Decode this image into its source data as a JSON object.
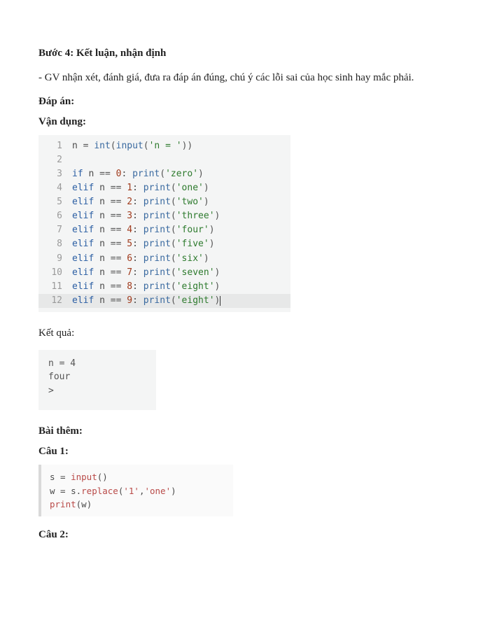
{
  "step_heading": "Bước 4: Kết luận, nhận định",
  "step_body": "- GV nhận xét, đánh giá, đưa ra đáp án đúng, chú ý các lỗi sai của học sinh hay mắc phải.",
  "answer_label": "Đáp án:",
  "apply_label": "Vận dụng:",
  "code_lines": [
    {
      "n": "1",
      "tokens": [
        "n ",
        "=",
        " ",
        "int",
        "(",
        "input",
        "(",
        "'n = '",
        ")",
        ")"
      ]
    },
    {
      "n": "2",
      "tokens": []
    },
    {
      "n": "3",
      "tokens": [
        "if",
        " n ",
        "==",
        " ",
        "0",
        ": ",
        "print",
        "(",
        "'zero'",
        ")"
      ]
    },
    {
      "n": "4",
      "tokens": [
        "elif",
        " n ",
        "==",
        " ",
        "1",
        ": ",
        "print",
        "(",
        "'one'",
        ")"
      ]
    },
    {
      "n": "5",
      "tokens": [
        "elif",
        " n ",
        "==",
        " ",
        "2",
        ": ",
        "print",
        "(",
        "'two'",
        ")"
      ]
    },
    {
      "n": "6",
      "tokens": [
        "elif",
        " n ",
        "==",
        " ",
        "3",
        ": ",
        "print",
        "(",
        "'three'",
        ")"
      ]
    },
    {
      "n": "7",
      "tokens": [
        "elif",
        " n ",
        "==",
        " ",
        "4",
        ": ",
        "print",
        "(",
        "'four'",
        ")"
      ]
    },
    {
      "n": "8",
      "tokens": [
        "elif",
        " n ",
        "==",
        " ",
        "5",
        ": ",
        "print",
        "(",
        "'five'",
        ")"
      ]
    },
    {
      "n": "9",
      "tokens": [
        "elif",
        " n ",
        "==",
        " ",
        "6",
        ": ",
        "print",
        "(",
        "'six'",
        ")"
      ]
    },
    {
      "n": "10",
      "tokens": [
        "elif",
        " n ",
        "==",
        " ",
        "7",
        ": ",
        "print",
        "(",
        "'seven'",
        ")"
      ]
    },
    {
      "n": "11",
      "tokens": [
        "elif",
        " n ",
        "==",
        " ",
        "8",
        ": ",
        "print",
        "(",
        "'eight'",
        ")"
      ]
    },
    {
      "n": "12",
      "tokens": [
        "elif",
        " n ",
        "==",
        " ",
        "9",
        ": ",
        "print",
        "(",
        "'eight'",
        ")"
      ],
      "highlighted": true,
      "cursor": true
    }
  ],
  "result_label": "Kết quả:",
  "output_text": "n = 4\nfour\n>",
  "extra_label": "Bài thêm:",
  "q1_label": "Câu 1:",
  "snippet1_lines": [
    {
      "plain": "s = ",
      "fn": "input",
      "plain2": "()"
    },
    {
      "plain": "w = s.",
      "fn": "replace",
      "plain2": "(",
      "str_a": "'1'",
      "comma": ",",
      "str_b": "'one'",
      "tail": ")"
    },
    {
      "fn": "print",
      "plain2": "(w)"
    }
  ],
  "q2_label": "Câu 2:"
}
